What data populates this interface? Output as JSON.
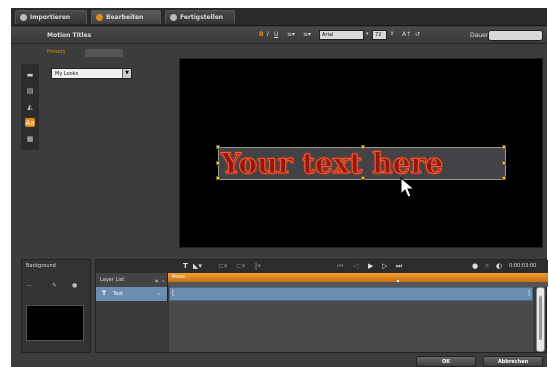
{
  "tabs": [
    {
      "label": "Importieren",
      "icon": "import-icon"
    },
    {
      "label": "Bearbeiten",
      "icon": "edit-icon",
      "active": true
    },
    {
      "label": "Fertigstellen",
      "icon": "finish-icon"
    }
  ],
  "panel_title": "Motion Titles",
  "format_toolbar": {
    "bold": "B",
    "italic": "I",
    "underline": "U",
    "font": "Arial",
    "size": "72",
    "dauer_label": "Dauer:",
    "dauer_value": ""
  },
  "presets": {
    "tab_label": "Presets",
    "selected": "My Looks"
  },
  "preview_text": "Your text here",
  "background_panel": {
    "title": "Background"
  },
  "timeline": {
    "layer_list_label": "Layer List",
    "ruler_label": "Motion",
    "layer_name": "Text",
    "timecode": "0:00:03:00"
  },
  "buttons": {
    "ok": "OK",
    "cancel": "Abbrechen"
  },
  "colors": {
    "accent": "#e08a1e",
    "track": "#6d8db0"
  }
}
